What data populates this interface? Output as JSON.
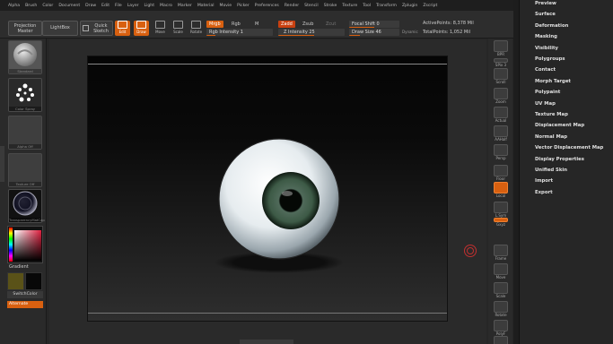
{
  "menu": [
    "Alpha",
    "Brush",
    "Color",
    "Document",
    "Draw",
    "Edit",
    "File",
    "Layer",
    "Light",
    "Macro",
    "Marker",
    "Material",
    "Movie",
    "Picker",
    "Preferences",
    "Render",
    "Stencil",
    "Stroke",
    "Texture",
    "Tool",
    "Transform",
    "Zplugin",
    "Zscript"
  ],
  "shelf": {
    "projection_master": "Projection Master",
    "lightbox": "LightBox",
    "quick_sketch": "Quick Sketch",
    "tools": {
      "edit": "Edit",
      "draw": "Draw",
      "move": "Move",
      "scale": "Scale",
      "rotate": "Rotate"
    },
    "mrgb": "Mrgb",
    "rgb": "Rgb",
    "m": "M",
    "zadd": "Zadd",
    "zsub": "Zsub",
    "zcut": "Zcut",
    "rgb_intensity": "Rgb Intensity 1",
    "z_intensity": "Z Intensity 25",
    "focal_shift": "Focal Shift 0",
    "draw_size": "Draw Size 46",
    "dynamic": "Dynamic",
    "active_points": "ActivePoints: 8,378 Mil",
    "total_points": "TotalPoints: 1,052 Mil"
  },
  "left_shelf": {
    "standard": "Standard",
    "color_spray": "Color Spray",
    "alpha_off": "Alpha Off",
    "texture_off": "Texture Off",
    "material": "TransparencyMatCap",
    "gradient": "Gradient",
    "switch_color": "SwitchColor",
    "alternate": "Alternate"
  },
  "right_dock": [
    {
      "icon": "sphere-icon",
      "label": "BPR"
    },
    {
      "icon": "spix-icon",
      "label": "SPix 3"
    },
    {
      "icon": "scroll-icon",
      "label": "Scroll"
    },
    {
      "icon": "zoom-icon",
      "label": "Zoom"
    },
    {
      "icon": "actual-icon",
      "label": "Actual"
    },
    {
      "icon": "aahalf-icon",
      "label": "AAHalf"
    },
    {
      "icon": "persp-icon",
      "label": "Persp"
    },
    {
      "icon": "floor-icon",
      "label": "Floor"
    },
    {
      "icon": "local-icon",
      "label": "Local"
    },
    {
      "icon": "lsym-icon",
      "label": "L.Sym"
    },
    {
      "icon": "xyz-icon",
      "label": "Gxyz"
    },
    {
      "icon": "frame-icon",
      "label": "Frame"
    },
    {
      "icon": "move-icon",
      "label": "Move"
    },
    {
      "icon": "scale-icon",
      "label": "Scale"
    },
    {
      "icon": "rotate-icon",
      "label": "Rotate"
    },
    {
      "icon": "polyf-icon",
      "label": "PolyF"
    },
    {
      "icon": "transp-icon",
      "label": ""
    }
  ],
  "tool_menu": [
    "Preview",
    "Surface",
    "Deformation",
    "Masking",
    "Visibility",
    "Polygroups",
    "Contact",
    "Morph Target",
    "Polypaint",
    "UV Map",
    "Texture Map",
    "Displacement Map",
    "Normal Map",
    "Vector Displacement Map",
    "Display Properties",
    "Unified Skin",
    "Import",
    "Export"
  ],
  "colors": {
    "accent": "#d86010",
    "bg": "#262626"
  }
}
